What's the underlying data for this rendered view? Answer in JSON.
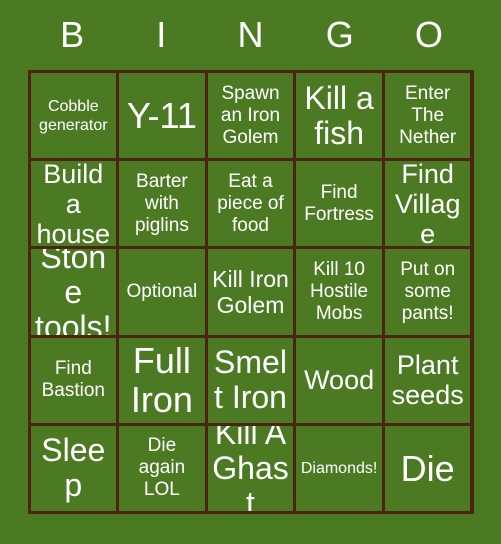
{
  "card": {
    "title": "BINGO",
    "background_color": "#4c7a23",
    "grid_line_color": "#4a2511",
    "text_color": "#ffffff",
    "header": {
      "letters": [
        "B",
        "I",
        "N",
        "G",
        "O"
      ]
    },
    "rows": [
      [
        {
          "text": "Cobble generator",
          "size": "fs-sm"
        },
        {
          "text": "Y-11",
          "size": "fs-xxxl"
        },
        {
          "text": "Spawn an Iron Golem",
          "size": "fs-md"
        },
        {
          "text": "Kill a fish",
          "size": "fs-xxl"
        },
        {
          "text": "Enter The Nether",
          "size": "fs-md"
        }
      ],
      [
        {
          "text": "Build a house",
          "size": "fs-xl"
        },
        {
          "text": "Barter with piglins",
          "size": "fs-md"
        },
        {
          "text": "Eat a piece of food",
          "size": "fs-md"
        },
        {
          "text": "Find Fortress",
          "size": "fs-md"
        },
        {
          "text": "Find Village",
          "size": "fs-xl"
        }
      ],
      [
        {
          "text": "Stone tools!",
          "size": "fs-xxl"
        },
        {
          "text": "Optional",
          "size": "fs-md"
        },
        {
          "text": "Kill Iron Golem",
          "size": "fs-lg"
        },
        {
          "text": "Kill 10 Hostile Mobs",
          "size": "fs-md"
        },
        {
          "text": "Put on some pants!",
          "size": "fs-md"
        }
      ],
      [
        {
          "text": "Find Bastion",
          "size": "fs-md"
        },
        {
          "text": "Full Iron",
          "size": "fs-xxxl"
        },
        {
          "text": "Smelt Iron",
          "size": "fs-xxl"
        },
        {
          "text": "Wood",
          "size": "fs-xl"
        },
        {
          "text": "Plant seeds",
          "size": "fs-xl"
        }
      ],
      [
        {
          "text": "Sleep",
          "size": "fs-xxl"
        },
        {
          "text": "Die again LOL",
          "size": "fs-md"
        },
        {
          "text": "Kill A Ghast",
          "size": "fs-xxl"
        },
        {
          "text": "Diamonds!",
          "size": "fs-sm"
        },
        {
          "text": "Die",
          "size": "fs-xxxl"
        }
      ]
    ]
  }
}
